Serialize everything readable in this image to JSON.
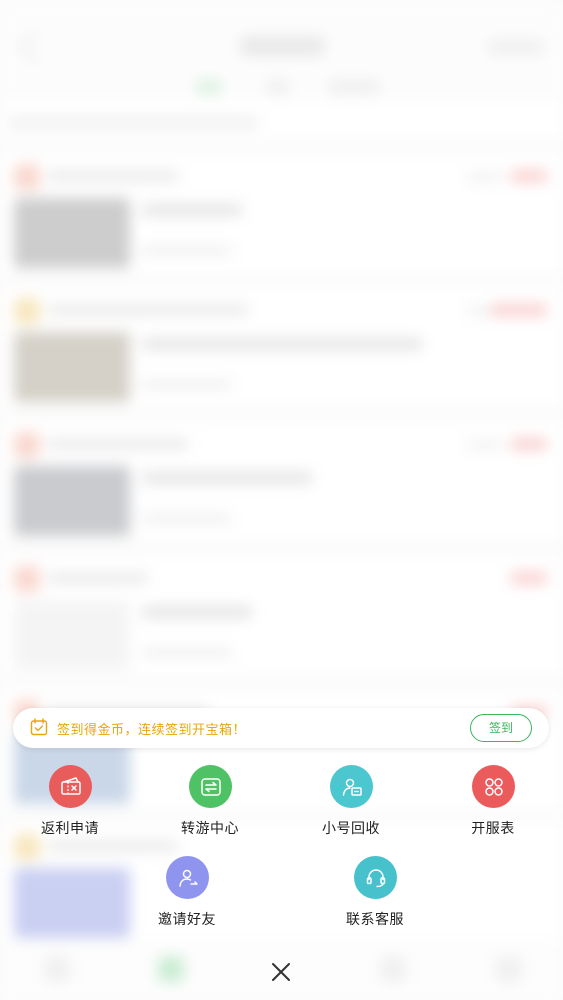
{
  "signin_banner": {
    "text": "签到得金币，连续签到开宝箱！",
    "button_label": "签到",
    "accent_color": "#e8a50c",
    "button_color": "#3cb55a"
  },
  "actions": [
    {
      "label": "返利申请",
      "icon": "ticket-icon",
      "color": "#e95c5c"
    },
    {
      "label": "转游中心",
      "icon": "transfer-icon",
      "color": "#4ec264"
    },
    {
      "label": "小号回收",
      "icon": "account-recycle-icon",
      "color": "#4cc6cf"
    },
    {
      "label": "开服表",
      "icon": "grid-icon",
      "color": "#ec5b5b"
    },
    {
      "label": "邀请好友",
      "icon": "invite-user-icon",
      "color": "#8f95ef"
    },
    {
      "label": "联系客服",
      "icon": "headset-icon",
      "color": "#47c1cc"
    }
  ],
  "close": {
    "icon": "close-icon"
  }
}
